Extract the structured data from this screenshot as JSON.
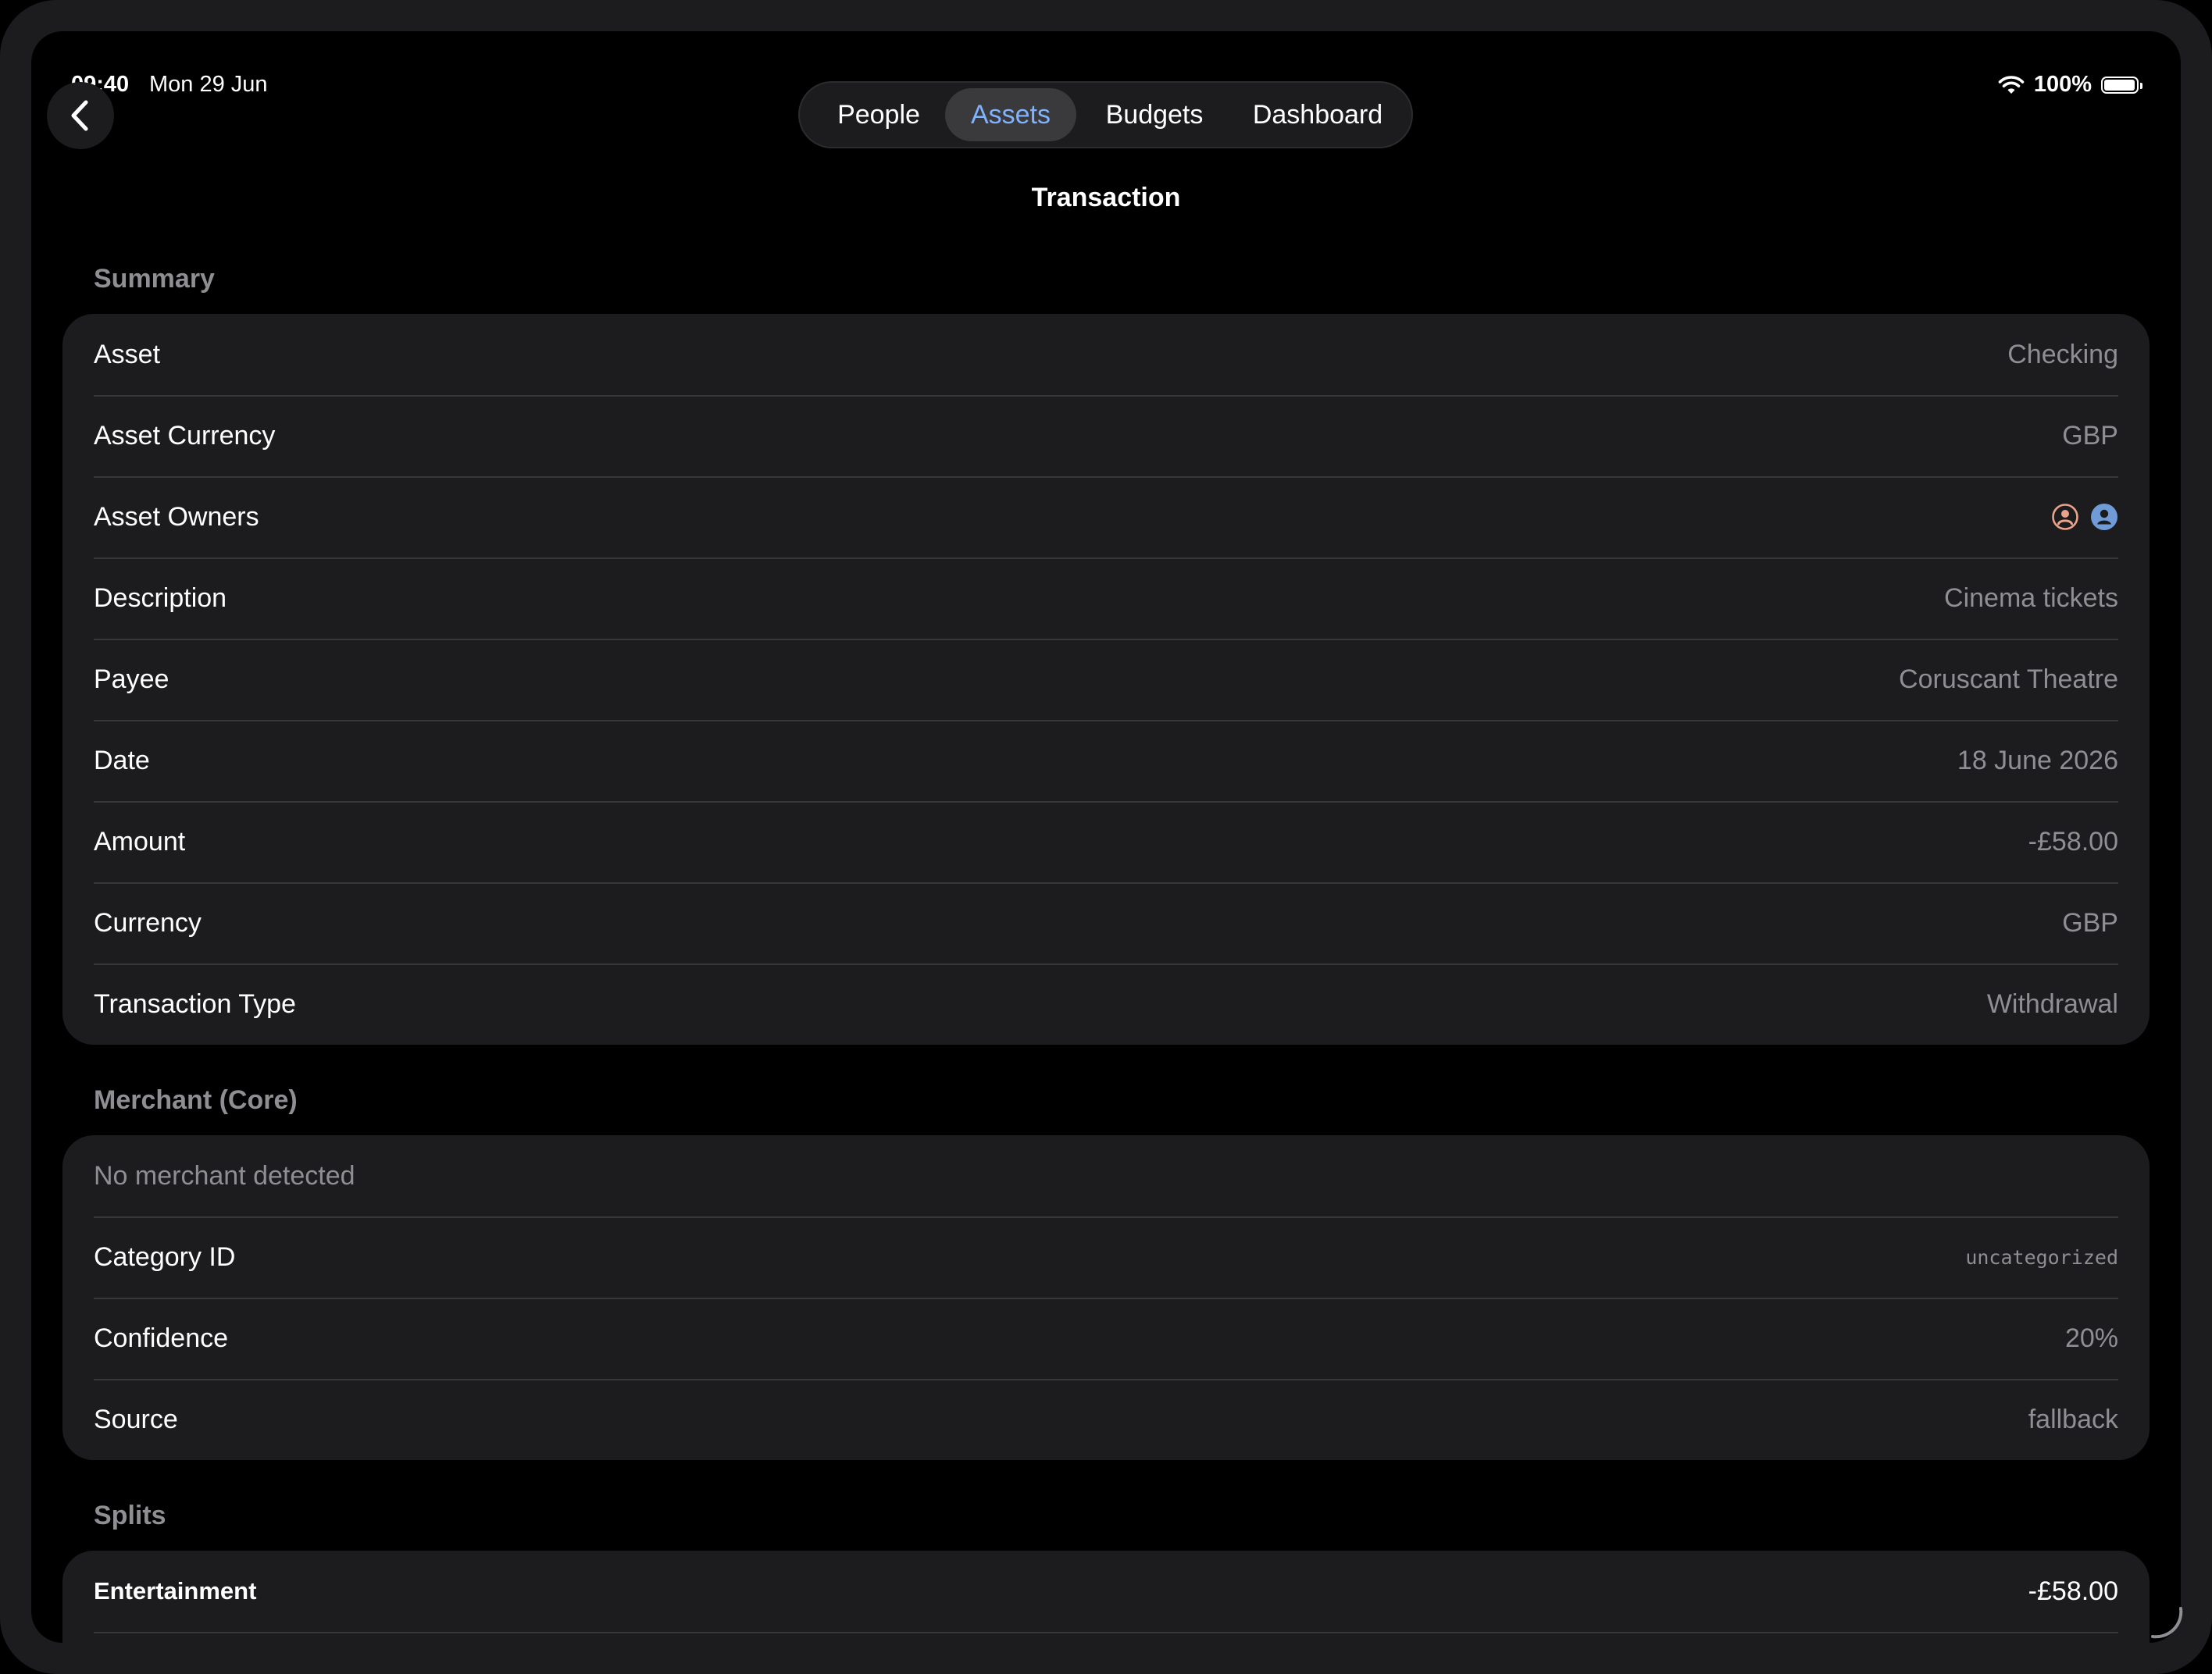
{
  "status_bar": {
    "time": "09:40",
    "date": "Mon 29 Jun",
    "battery": "100%",
    "battery_level": 1.0
  },
  "nav": {
    "tabs": [
      {
        "label": "People",
        "active": false
      },
      {
        "label": "Assets",
        "active": true
      },
      {
        "label": "Budgets",
        "active": false
      },
      {
        "label": "Dashboard",
        "active": false
      }
    ],
    "title": "Transaction"
  },
  "summary": {
    "header": "Summary",
    "rows": [
      {
        "label": "Asset",
        "value": "Checking"
      },
      {
        "label": "Asset Currency",
        "value": "GBP"
      },
      {
        "label": "Asset Owners",
        "icons": [
          "person-circle-icon",
          "person-circle-fill-icon"
        ]
      },
      {
        "label": "Description",
        "value": "Cinema tickets"
      },
      {
        "label": "Payee",
        "value": "Coruscant Theatre"
      },
      {
        "label": "Date",
        "value": "18 June 2026"
      },
      {
        "label": "Amount",
        "value": "-£58.00"
      },
      {
        "label": "Currency",
        "value": "GBP"
      },
      {
        "label": "Transaction Type",
        "value": "Withdrawal"
      }
    ]
  },
  "merchant": {
    "header": "Merchant (Core)",
    "empty": "No merchant detected",
    "rows": [
      {
        "label": "Category ID",
        "value": "uncategorized"
      },
      {
        "label": "Confidence",
        "value": "20%"
      },
      {
        "label": "Source",
        "value": "fallback"
      }
    ]
  },
  "splits": {
    "header": "Splits",
    "rows": [
      {
        "label": "Entertainment",
        "value": "-£58.00"
      }
    ]
  },
  "colors": {
    "accent": "#7fb2ff",
    "owner_1": "#e8a38a",
    "owner_2": "#6f9bd6",
    "background": "#000000",
    "card": "#1c1c1e",
    "secondary_text": "#8e8e93"
  }
}
